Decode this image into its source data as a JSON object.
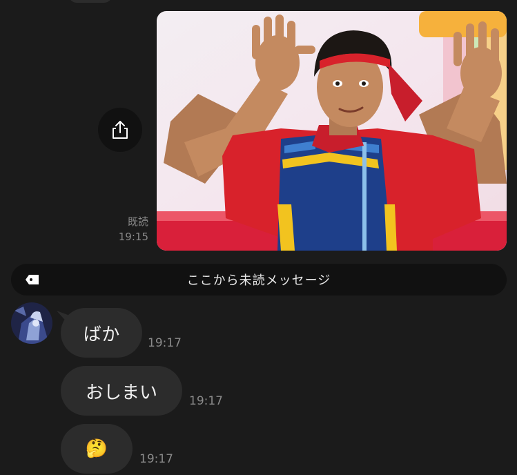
{
  "sent": {
    "photo_subject": "man in colorful jacket with red bandana raising both hands",
    "read_label": "既読",
    "time": "19:15",
    "share_icon": "share-upload-icon"
  },
  "divider": {
    "label": "ここから未読メッセージ",
    "icon": "tag-icon"
  },
  "received": {
    "avatar_icon": "user-avatar",
    "messages": [
      {
        "text": "ばか",
        "time": "19:17"
      },
      {
        "text": "おしまい",
        "time": "19:17"
      },
      {
        "text": "🤔",
        "time": "19:17",
        "emoji": "thinking-face"
      }
    ]
  },
  "colors": {
    "background": "#1b1b1b",
    "bubble": "#2c2c2c",
    "divider": "#111111",
    "meta_text": "#8a8a8a"
  }
}
